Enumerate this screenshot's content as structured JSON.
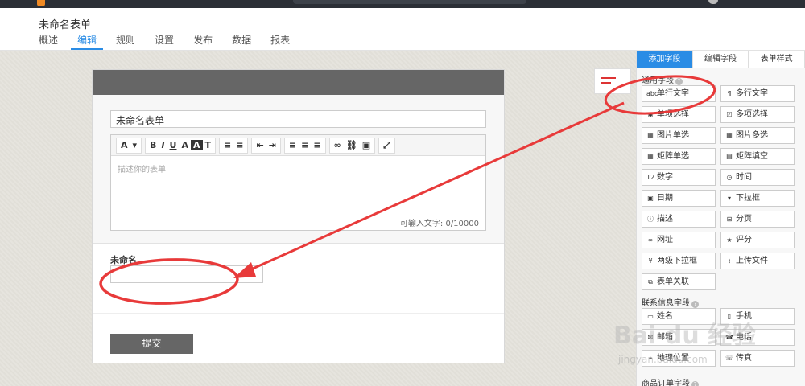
{
  "header": {
    "form_name": "未命名表单",
    "tabs": [
      {
        "label": "概述"
      },
      {
        "label": "编辑",
        "active": true
      },
      {
        "label": "规则"
      },
      {
        "label": "设置"
      },
      {
        "label": "发布"
      },
      {
        "label": "数据"
      },
      {
        "label": "报表"
      }
    ]
  },
  "form": {
    "title_value": "未命名表单",
    "description_placeholder": "描述你的表单",
    "char_counter": "可输入文字: 0/10000",
    "field_label": "未命名",
    "submit_label": "提交",
    "toolbar": [
      "A",
      "B",
      "I",
      "U",
      "A",
      "A",
      "T",
      "≡",
      "≡",
      "⇤",
      "⇥",
      "≡",
      "≡",
      "≡",
      "∞",
      "⛓",
      "▣",
      "⤢"
    ]
  },
  "panel": {
    "tabs": [
      {
        "label": "添加字段",
        "active": true
      },
      {
        "label": "编辑字段"
      },
      {
        "label": "表单样式"
      }
    ],
    "sections": [
      {
        "title": "通用字段",
        "fields": [
          {
            "label": "单行文字",
            "icon": "abc-icon"
          },
          {
            "label": "多行文字",
            "icon": "paragraph-icon"
          },
          {
            "label": "单项选择",
            "icon": "radio-icon"
          },
          {
            "label": "多项选择",
            "icon": "checkbox-icon"
          },
          {
            "label": "图片单选",
            "icon": "image-radio-icon"
          },
          {
            "label": "图片多选",
            "icon": "image-checkbox-icon"
          },
          {
            "label": "矩阵单选",
            "icon": "matrix-icon"
          },
          {
            "label": "矩阵填空",
            "icon": "matrix-fill-icon"
          },
          {
            "label": "数字",
            "icon": "number-icon"
          },
          {
            "label": "时间",
            "icon": "clock-icon"
          },
          {
            "label": "日期",
            "icon": "calendar-icon"
          },
          {
            "label": "下拉框",
            "icon": "dropdown-icon"
          },
          {
            "label": "描述",
            "icon": "info-icon"
          },
          {
            "label": "分页",
            "icon": "page-break-icon"
          },
          {
            "label": "网址",
            "icon": "link-icon"
          },
          {
            "label": "评分",
            "icon": "star-icon"
          },
          {
            "label": "两级下拉框",
            "icon": "cascade-icon"
          },
          {
            "label": "上传文件",
            "icon": "paperclip-icon"
          },
          {
            "label": "表单关联",
            "icon": "relation-icon"
          }
        ]
      },
      {
        "title": "联系信息字段",
        "fields": [
          {
            "label": "姓名",
            "icon": "name-card-icon"
          },
          {
            "label": "手机",
            "icon": "mobile-icon"
          },
          {
            "label": "邮箱",
            "icon": "mail-icon"
          },
          {
            "label": "电话",
            "icon": "phone-icon"
          },
          {
            "label": "地理位置",
            "icon": "location-icon"
          },
          {
            "label": "传真",
            "icon": "fax-icon"
          }
        ]
      },
      {
        "title": "商品订单字段",
        "fields": []
      }
    ]
  },
  "watermark": {
    "brand": "Bai du 经验",
    "url": "jingyan.baidu.com"
  },
  "colors": {
    "accent": "#2a8ce5",
    "annotation": "#e83a3a",
    "card_header": "#666666"
  }
}
